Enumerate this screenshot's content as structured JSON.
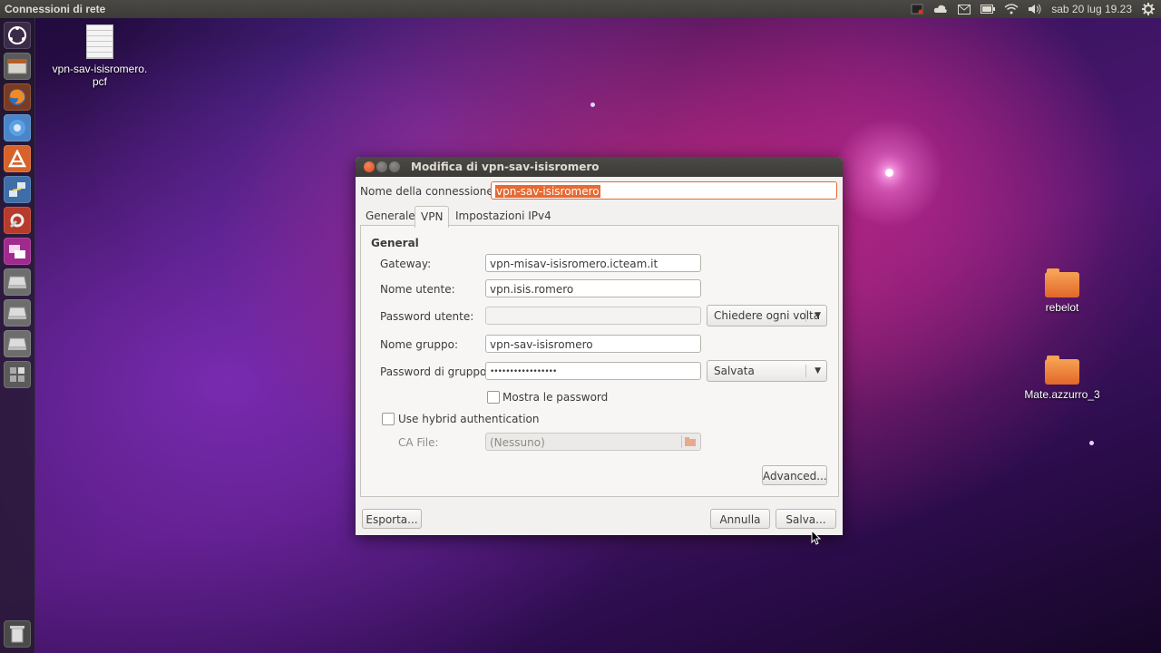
{
  "top_panel": {
    "app_title": "Connessioni di rete",
    "clock": "sab 20 lug  19.23",
    "indicators": [
      "recording-icon",
      "cloud-icon",
      "mail-icon",
      "battery-icon",
      "wifi-icon",
      "speaker-icon",
      "gear-icon"
    ]
  },
  "launcher": {
    "items": [
      "dash-home",
      "file-manager",
      "firefox",
      "chromium",
      "software-center",
      "network-settings",
      "system-settings",
      "remote-desktop",
      "drive-1",
      "drive-2",
      "drive-3",
      "workspaces",
      "trash"
    ]
  },
  "desktop": {
    "icons": [
      {
        "label": "vpn-sav-isisromero.\npcf",
        "kind": "file"
      },
      {
        "label": "rebelot",
        "kind": "folder"
      },
      {
        "label": "Mate.azzurro_3",
        "kind": "folder"
      }
    ]
  },
  "dialog": {
    "title": "Modifica di vpn-sav-isisromero",
    "connection_name_label": "Nome della connessione:",
    "connection_name_value": "vpn-sav-isisromero",
    "tabs": [
      "Generale",
      "VPN",
      "Impostazioni IPv4"
    ],
    "active_tab": "VPN",
    "section_title": "General",
    "gateway_label": "Gateway:",
    "gateway_value": "vpn-misav-isisromero.icteam.it",
    "username_label": "Nome utente:",
    "username_value": "vpn.isis.romero",
    "user_password_label": "Password utente:",
    "user_password_value": "",
    "user_password_mode": "Chiedere ogni volta",
    "group_name_label": "Nome gruppo:",
    "group_name_value": "vpn-sav-isisromero",
    "group_password_label": "Password di gruppo:",
    "group_password_value": "•••••••••••••••••",
    "group_password_mode": "Salvata",
    "show_passwords_label": "Mostra le password",
    "hybrid_auth_label": "Use hybrid authentication",
    "ca_file_label": "CA File:",
    "ca_file_value": "(Nessuno)",
    "advanced_button": "Advanced...",
    "export_button": "Esporta...",
    "cancel_button": "Annulla",
    "save_button": "Salva..."
  }
}
